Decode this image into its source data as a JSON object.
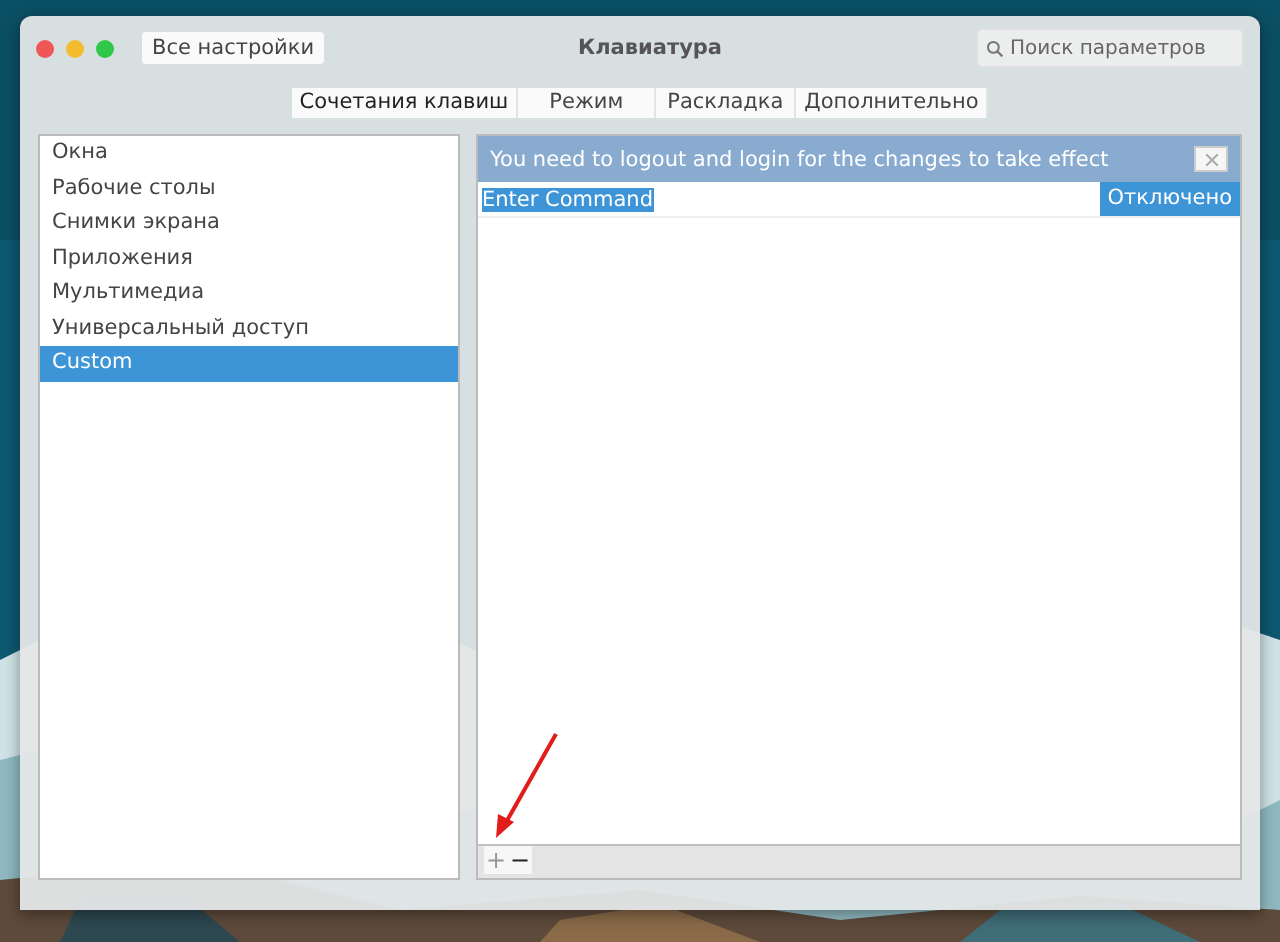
{
  "window": {
    "title": "Клавиатура",
    "back_button": "Все настройки",
    "search": {
      "placeholder": "Поиск параметров"
    }
  },
  "tabs": [
    {
      "label": "Сочетания клавиш",
      "selected": true
    },
    {
      "label": "Режим",
      "selected": false
    },
    {
      "label": "Раскладка",
      "selected": false
    },
    {
      "label": "Дополнительно",
      "selected": false
    }
  ],
  "sidebar": {
    "items": [
      {
        "label": "Окна",
        "selected": false
      },
      {
        "label": "Рабочие столы",
        "selected": false
      },
      {
        "label": "Снимки экрана",
        "selected": false
      },
      {
        "label": "Приложения",
        "selected": false
      },
      {
        "label": "Мультимедиа",
        "selected": false
      },
      {
        "label": "Универсальный доступ",
        "selected": false
      },
      {
        "label": "Custom",
        "selected": true
      }
    ]
  },
  "infobar": {
    "message": "You need to logout and login for the changes to take effect"
  },
  "shortcuts": [
    {
      "command": "Enter Command",
      "editing": true,
      "shortcut": "Отключено"
    }
  ],
  "toolbar": [
    {
      "label": "+",
      "disabled": true
    },
    {
      "label": "−",
      "disabled": false
    }
  ]
}
